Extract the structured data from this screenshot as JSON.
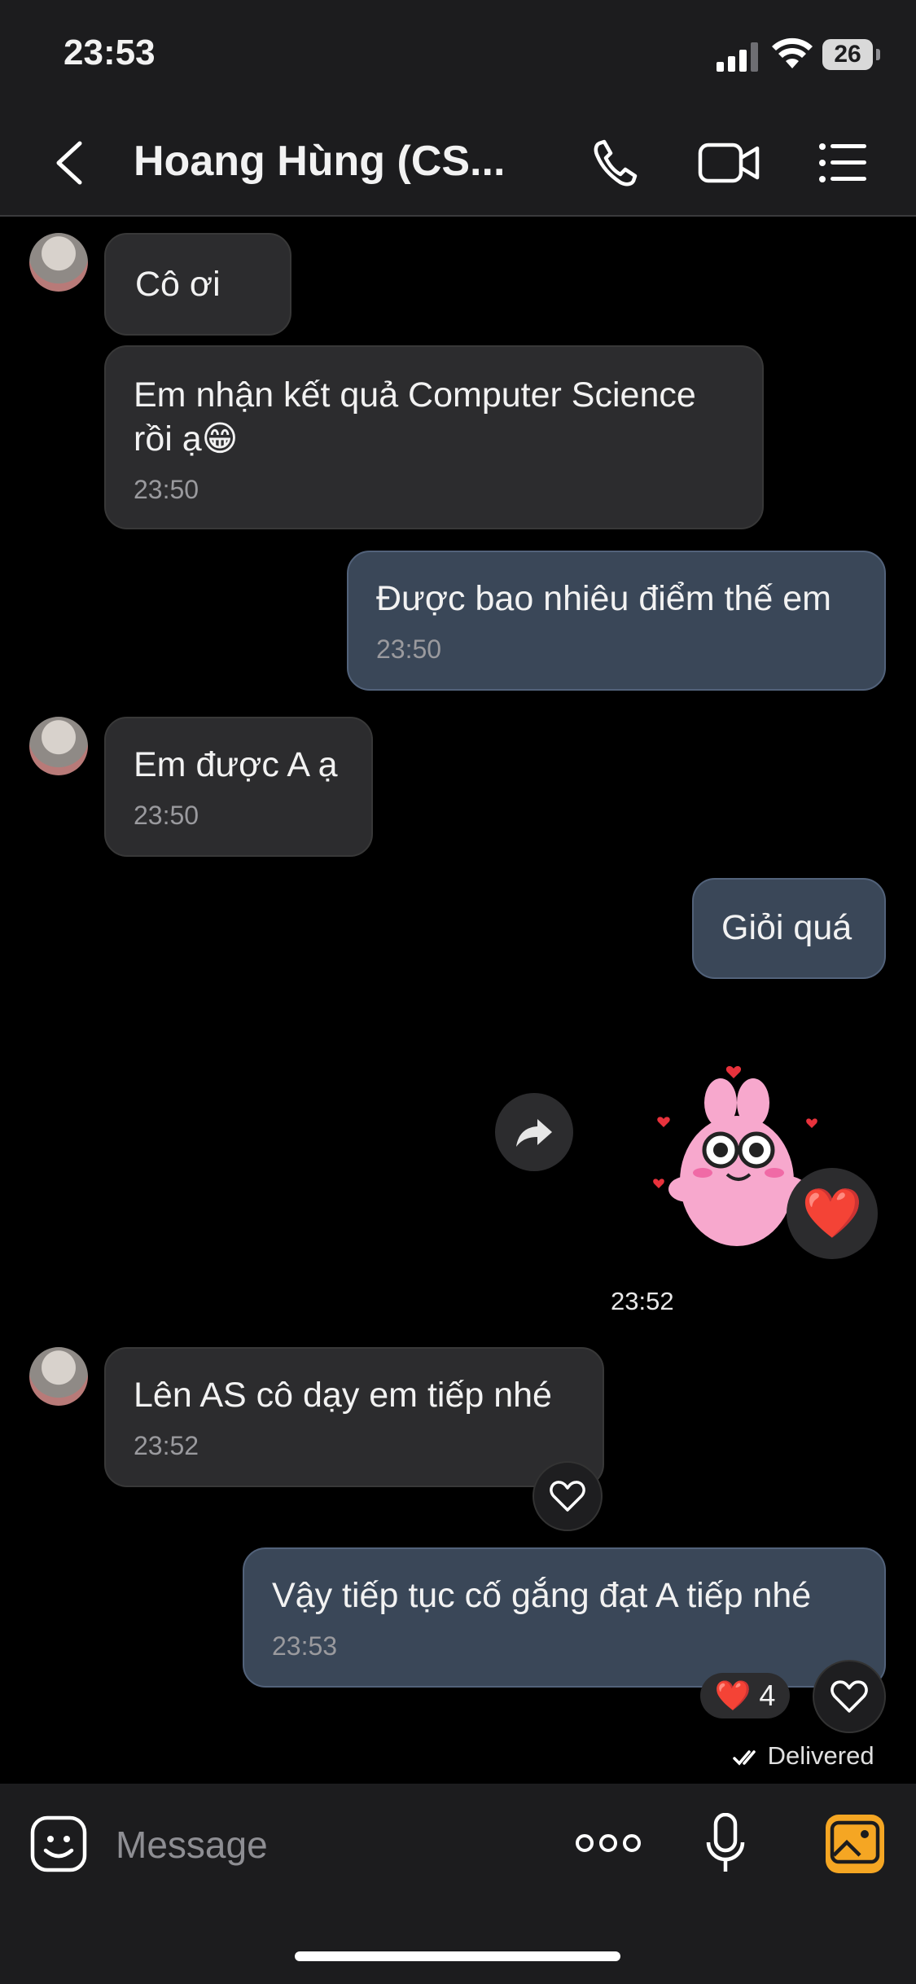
{
  "status_bar": {
    "time": "23:53",
    "battery": "26"
  },
  "header": {
    "contact_name": "Hoang Hùng (CS...",
    "icons": [
      "back-icon",
      "phone-icon",
      "video-icon",
      "menu-list-icon"
    ]
  },
  "messages": [
    {
      "direction": "incoming",
      "text": "Cô ơi",
      "time": ""
    },
    {
      "direction": "incoming",
      "text": "Em nhận kết quả Computer Science rồi ạ😁",
      "time": "23:50"
    },
    {
      "direction": "outgoing",
      "text": "Được bao nhiêu điểm thế em",
      "time": "23:50"
    },
    {
      "direction": "incoming",
      "text": "Em được A ạ",
      "time": "23:50"
    },
    {
      "direction": "outgoing",
      "text": "Giỏi quá",
      "time": ""
    },
    {
      "direction": "outgoing",
      "type": "sticker",
      "sticker": "pink-bunny-love-sticker",
      "reaction": "❤️",
      "time": "23:52"
    },
    {
      "direction": "incoming",
      "text": "Lên AS cô dạy em tiếp nhé",
      "time": "23:52"
    },
    {
      "direction": "outgoing",
      "text": "Vậy tiếp tục cố gắng đạt A tiếp nhé",
      "time": "23:53",
      "reaction_emoji": "❤️",
      "reaction_count": "4"
    }
  ],
  "delivery_status": "Delivered",
  "composer": {
    "placeholder": "Message",
    "icons": [
      "sticker-face-icon",
      "more-dots-icon",
      "microphone-icon",
      "gallery-icon"
    ]
  },
  "colors": {
    "incoming_bubble": "#2c2c2e",
    "outgoing_bubble": "#3a4758",
    "gallery_accent": "#f5a623",
    "heart": "#e8323c"
  }
}
